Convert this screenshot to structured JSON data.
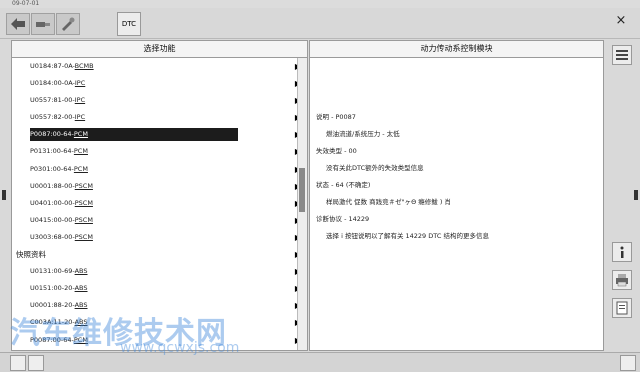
{
  "window": {
    "title": "09-07-01"
  },
  "toolbar": {
    "dtc_label": "DTC",
    "close_glyph": "×"
  },
  "left_panel": {
    "title": "选择功能",
    "rows": [
      {
        "code": "U0184:87-0A-",
        "ecu": "BCMB",
        "type": "item"
      },
      {
        "code": "U0184:00-0A-",
        "ecu": "IPC",
        "type": "item"
      },
      {
        "code": "U0557:81-00-",
        "ecu": "IPC",
        "type": "item"
      },
      {
        "code": "U0557:82-00-",
        "ecu": "IPC",
        "type": "item"
      },
      {
        "code": "P0087:00-64-",
        "ecu": "PCM",
        "type": "selected"
      },
      {
        "code": "P0131:00-64-",
        "ecu": "PCM",
        "type": "item"
      },
      {
        "code": "P0301:00-64-",
        "ecu": "PCM",
        "type": "item"
      },
      {
        "code": "U0001:88-00-",
        "ecu": "PSCM",
        "type": "item"
      },
      {
        "code": "U0401:00-00-",
        "ecu": "PSCM",
        "type": "item"
      },
      {
        "code": "U0415:00-00-",
        "ecu": "PSCM",
        "type": "item"
      },
      {
        "code": "U3003:68-00-",
        "ecu": "PSCM",
        "type": "item"
      },
      {
        "code": "快照资料",
        "ecu": "",
        "type": "header"
      },
      {
        "code": "U0131:00-69-",
        "ecu": "ABS",
        "type": "item"
      },
      {
        "code": "U0151:00-20-",
        "ecu": "ABS",
        "type": "item"
      },
      {
        "code": "U0001:88-20-",
        "ecu": "ABS",
        "type": "item"
      },
      {
        "code": "C003A:11-20-",
        "ecu": "ABS",
        "type": "item"
      },
      {
        "code": "P0087:00-64-",
        "ecu": "PCM",
        "type": "item"
      }
    ],
    "arrow_glyph": "▶"
  },
  "right_panel": {
    "title": "动力传动系控制模块",
    "lines": [
      {
        "text": "说明 - P0087",
        "indent": false
      },
      {
        "text": "燃油流道/系统压力 - 太低",
        "indent": true
      },
      {
        "text": "失效类型 - 00",
        "indent": false
      },
      {
        "text": "没有关此DTC额外的失效类型信息",
        "indent": true
      },
      {
        "text": "状态 - 64 (不确定)",
        "indent": false
      },
      {
        "text": "样局激代    促数      商践竞＃ゼ\"ヶΘ    瘾修鲅 )      肖",
        "indent": true
      },
      {
        "text": "诊断协议 - 14229",
        "indent": false
      },
      {
        "text": "选择 i 按钮说明以了解有关 14229 DTC 结构的更多信息",
        "indent": true
      }
    ]
  },
  "watermark": {
    "text": "汽车维修技术网",
    "url": "www.qcwxjs.com"
  }
}
